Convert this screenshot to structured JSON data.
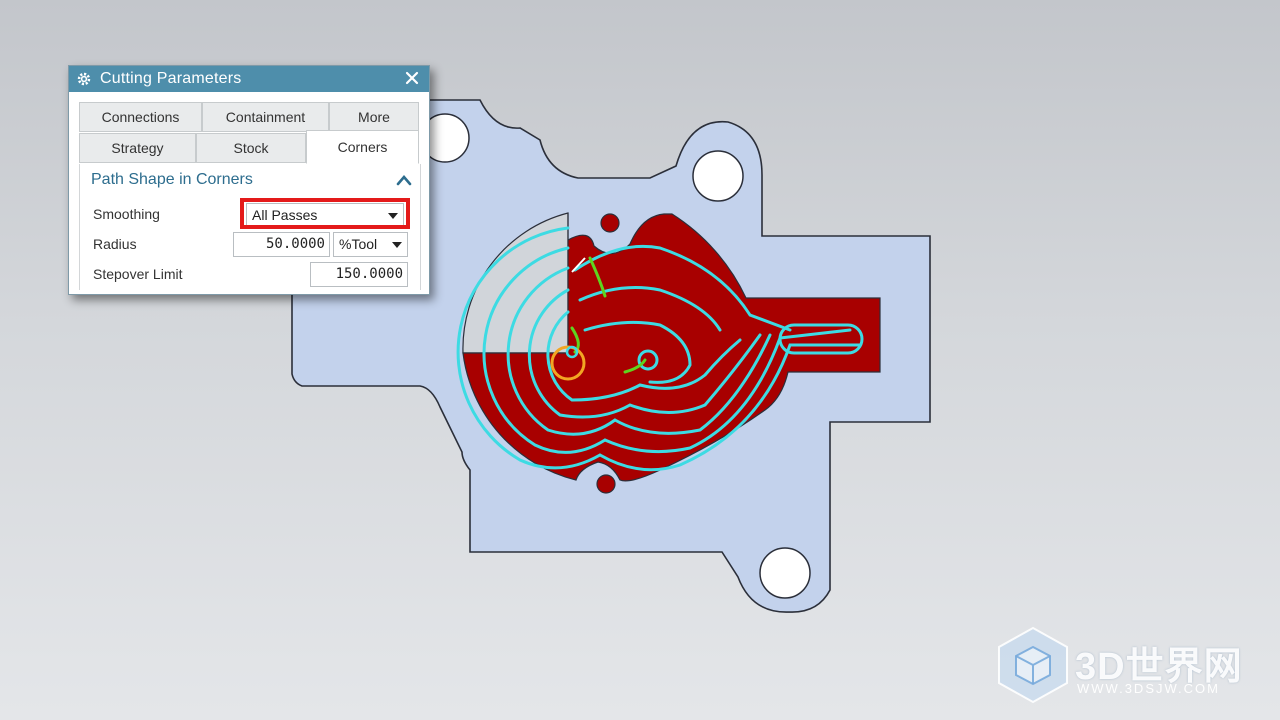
{
  "dialog": {
    "title": "Cutting Parameters",
    "tabs_row1": [
      "Connections",
      "Containment",
      "More"
    ],
    "tabs_row2": [
      "Strategy",
      "Stock",
      "Corners"
    ],
    "active_tab": "Corners",
    "section": {
      "title": "Path Shape in Corners",
      "smoothing": {
        "label": "Smoothing",
        "value": "All Passes"
      },
      "radius": {
        "label": "Radius",
        "value": "50.0000",
        "unit": "%Tool"
      },
      "stepover_limit": {
        "label": "Stepover Limit",
        "value": "150.0000"
      }
    }
  },
  "watermark": {
    "brand": "3D世界网",
    "url": "WWW.3DSJW.COM"
  },
  "colors": {
    "titlebar": "#4e8eab",
    "part": "#c3d2ec",
    "cut_region": "#a80000",
    "toolpath": "#3ddbe3",
    "transition": "#5fd41f",
    "highlight": "#e41a1a"
  }
}
